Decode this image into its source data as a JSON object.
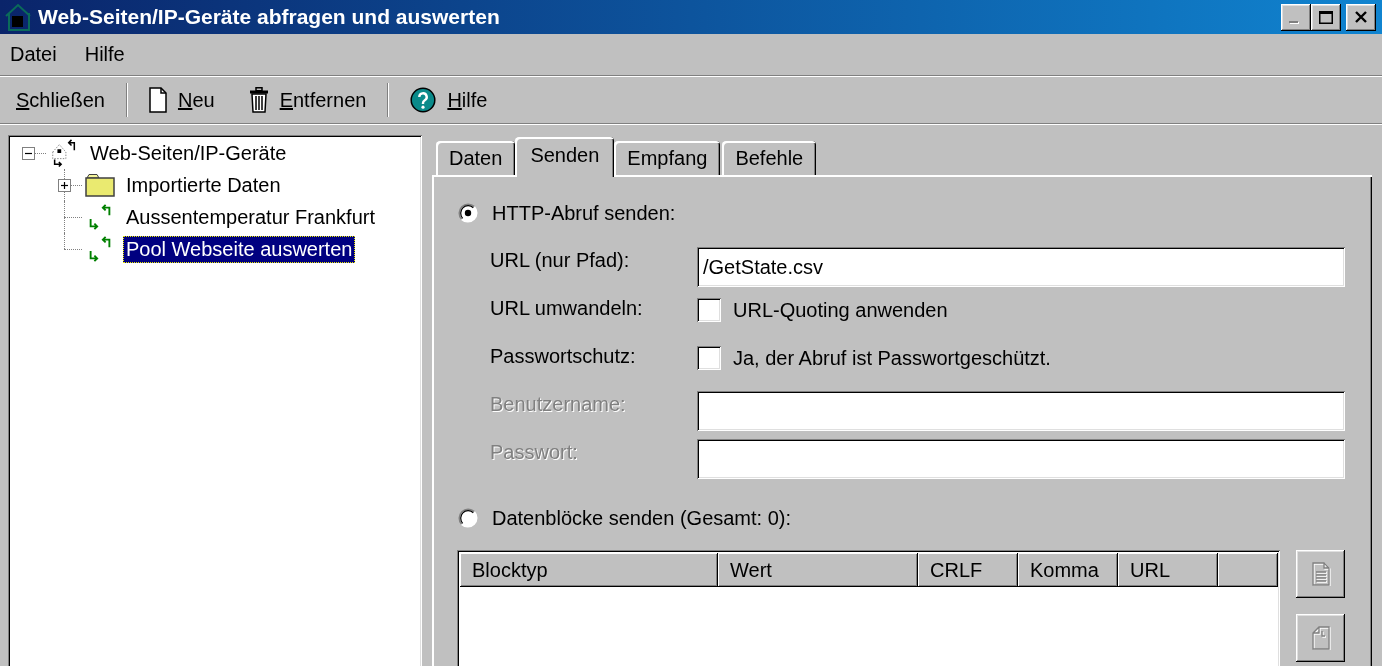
{
  "window": {
    "title": "Web-Seiten/IP-Geräte abfragen und auswerten",
    "buttons": [
      {
        "disabled": true
      },
      {
        "disabled": false
      },
      {
        "disabled": false
      }
    ]
  },
  "menu": [
    {
      "label": "Datei"
    },
    {
      "label": "Hilfe"
    }
  ],
  "toolbar": [
    [
      {
        "label": "Schließen",
        "mnemonic": true
      }
    ],
    [
      {
        "label": "Neu",
        "mnemonic": true
      },
      {
        "label": "Entfernen",
        "mnemonic": true
      }
    ],
    [
      {
        "label": "Hilfe",
        "mnemonic": true
      }
    ]
  ],
  "tree": [
    {
      "label": "Web-Seiten/IP-Geräte",
      "kind": "root",
      "expanded": true,
      "selected": false,
      "children": [
        {
          "label": "Importierte Daten",
          "kind": "folder",
          "expanded": false,
          "selected": false
        },
        {
          "label": "Aussentemperatur Frankfurt",
          "kind": "item",
          "selected": false
        },
        {
          "label": "Pool Webseite auswerten",
          "kind": "item",
          "selected": true
        }
      ]
    }
  ],
  "tabs": [
    {
      "label": "Daten",
      "selected": false
    },
    {
      "label": "Senden",
      "selected": true
    },
    {
      "label": "Empfang",
      "selected": false
    },
    {
      "label": "Befehle",
      "selected": false
    }
  ],
  "send_options": [
    {
      "label": "HTTP-Abruf senden:",
      "selected": true
    },
    {
      "label": "Datenblöcke senden (Gesamt: 0):",
      "selected": false
    }
  ],
  "fields": [
    {
      "kind": "text",
      "label": "URL (nur Pfad):",
      "value": "/GetState.csv",
      "disabled": false
    },
    {
      "kind": "checkbox",
      "label": "URL umwandeln:",
      "text": "URL-Quoting anwenden",
      "checked": false
    },
    {
      "kind": "checkbox",
      "label": "Passwortschutz:",
      "text": "Ja, der Abruf ist Passwortgeschützt.",
      "checked": false
    },
    {
      "kind": "text",
      "label": "Benutzername:",
      "disabled": true
    },
    {
      "kind": "text",
      "label": "Passwort:",
      "disabled": true
    }
  ],
  "blocks_table": {
    "columns": [
      "Blocktyp",
      "Wert",
      "CRLF",
      "Komma",
      "URL"
    ]
  },
  "side_buttons": [
    {
      "disabled": true
    },
    {
      "disabled": true
    }
  ]
}
